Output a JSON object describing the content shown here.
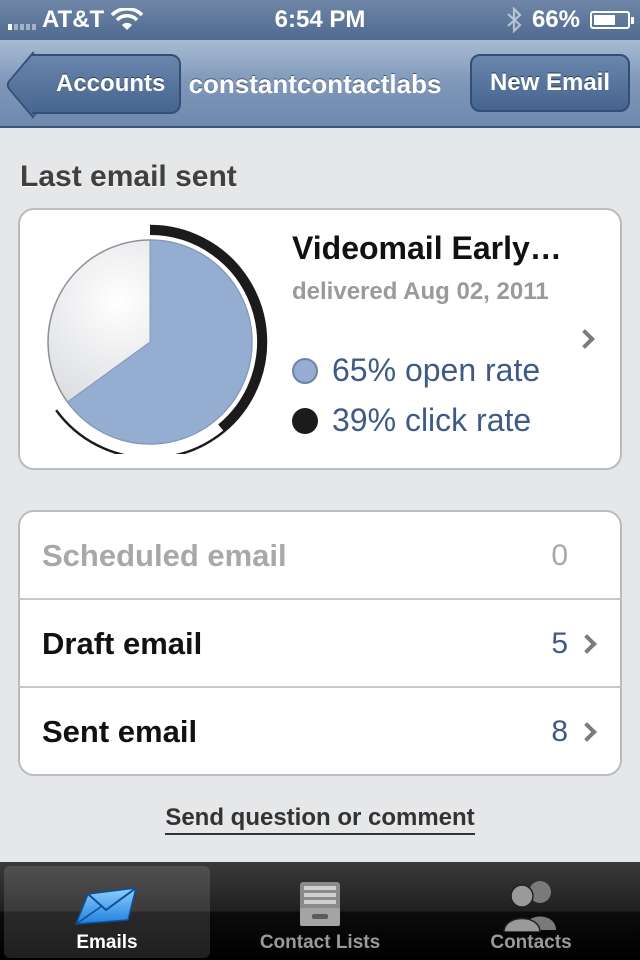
{
  "status_bar": {
    "carrier": "AT&T",
    "time": "6:54 PM",
    "battery": "66%",
    "battery_level": 0.66
  },
  "nav": {
    "back_label": "Accounts",
    "title": "constantcontactlabs",
    "right_label": "New Email"
  },
  "section": {
    "heading": "Last email sent"
  },
  "summary": {
    "title": "Videomail Early…",
    "subtitle": "delivered Aug 02, 2011",
    "open_rate_text": "65% open rate",
    "click_rate_text": "39% click rate",
    "open_rate": 0.65,
    "click_rate": 0.39
  },
  "table": {
    "rows": [
      {
        "label": "Scheduled email",
        "count": "0",
        "disabled": true
      },
      {
        "label": "Draft email",
        "count": "5",
        "disabled": false
      },
      {
        "label": "Sent email",
        "count": "8",
        "disabled": false
      }
    ]
  },
  "feedback": {
    "label": "Send question or comment"
  },
  "tabs": [
    {
      "label": "Emails",
      "icon": "envelope-icon",
      "active": true
    },
    {
      "label": "Contact Lists",
      "icon": "file-tray-icon",
      "active": false
    },
    {
      "label": "Contacts",
      "icon": "people-icon",
      "active": false
    }
  ],
  "colors": {
    "nav_blue": "#6e89ae",
    "link_blue": "#3f5a86",
    "open_rate_fill": "#95add0",
    "click_rate_fill": "#1b1b1b"
  }
}
